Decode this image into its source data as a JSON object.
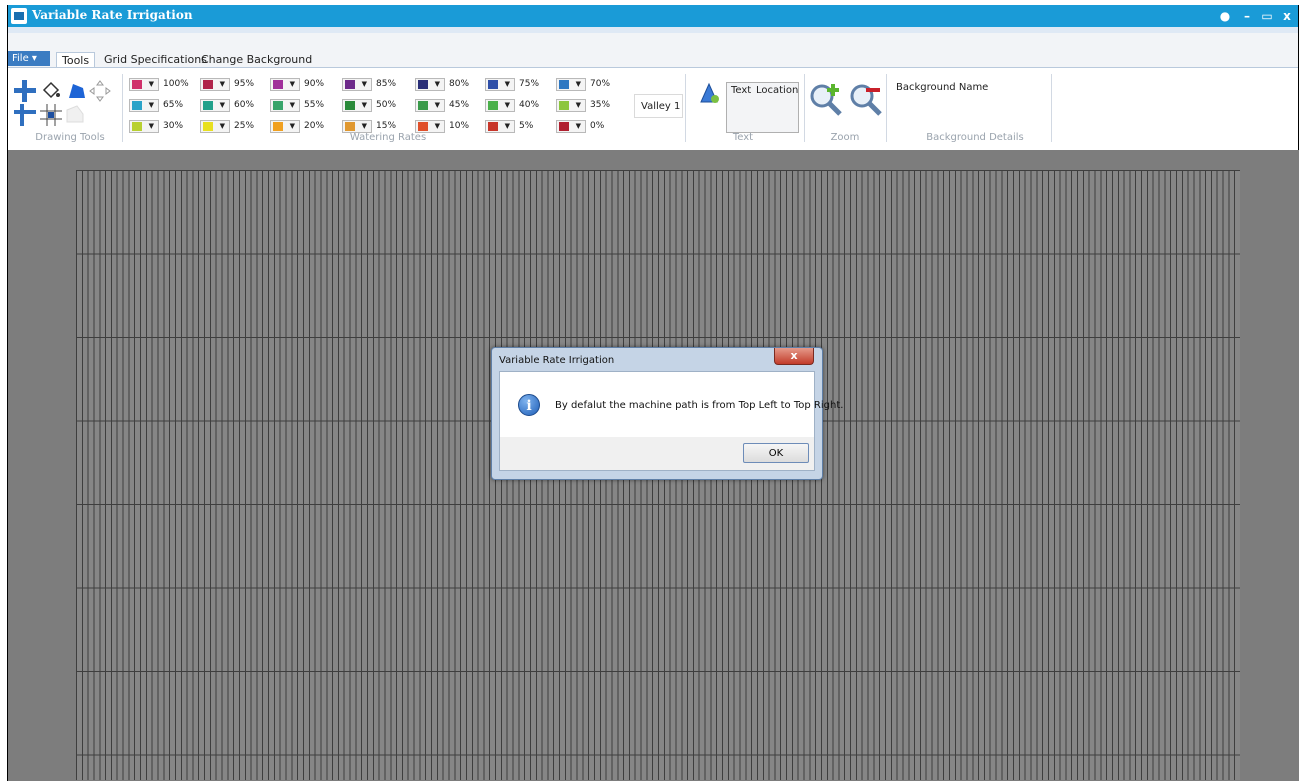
{
  "app": {
    "title": "Variable Rate Irrigation"
  },
  "window_controls": {
    "help": "●",
    "minimize": "–",
    "maximize": "▭",
    "close": "x"
  },
  "tabs": {
    "file": "File",
    "items": [
      "Tools",
      "Grid Specifications",
      "Change Background"
    ]
  },
  "ribbon": {
    "groups": {
      "drawing_tools": "Drawing Tools",
      "watering_rates": "Watering Rates",
      "text": "Text",
      "zoom": "Zoom",
      "background_details": "Background Details"
    },
    "rates": [
      {
        "pct": "100%",
        "color": "#d0306a"
      },
      {
        "pct": "95%",
        "color": "#b0244a"
      },
      {
        "pct": "90%",
        "color": "#a02f9a"
      },
      {
        "pct": "85%",
        "color": "#6d2a8a"
      },
      {
        "pct": "80%",
        "color": "#2a2f78"
      },
      {
        "pct": "75%",
        "color": "#2f4fa8"
      },
      {
        "pct": "70%",
        "color": "#2f78c2"
      },
      {
        "pct": "65%",
        "color": "#2aa3c8"
      },
      {
        "pct": "60%",
        "color": "#21a08a"
      },
      {
        "pct": "55%",
        "color": "#38a46a"
      },
      {
        "pct": "50%",
        "color": "#2a8a3a"
      },
      {
        "pct": "45%",
        "color": "#3a9a4a"
      },
      {
        "pct": "40%",
        "color": "#4ab04a"
      },
      {
        "pct": "35%",
        "color": "#8cc63e"
      },
      {
        "pct": "30%",
        "color": "#b8d030"
      },
      {
        "pct": "25%",
        "color": "#e8e020"
      },
      {
        "pct": "20%",
        "color": "#f0a020"
      },
      {
        "pct": "15%",
        "color": "#e09830"
      },
      {
        "pct": "10%",
        "color": "#e0502a"
      },
      {
        "pct": "5%",
        "color": "#c8362a"
      },
      {
        "pct": "0%",
        "color": "#b02030"
      }
    ],
    "valley": "Valley 1",
    "text_fields": {
      "text": "Text",
      "location": "Location"
    },
    "background_name": "Background Name"
  },
  "dialog": {
    "title": "Variable Rate Irrigation",
    "message": "By defalut the machine path is from Top Left to Top Right.",
    "ok": "OK",
    "close": "x",
    "icon": "i"
  }
}
